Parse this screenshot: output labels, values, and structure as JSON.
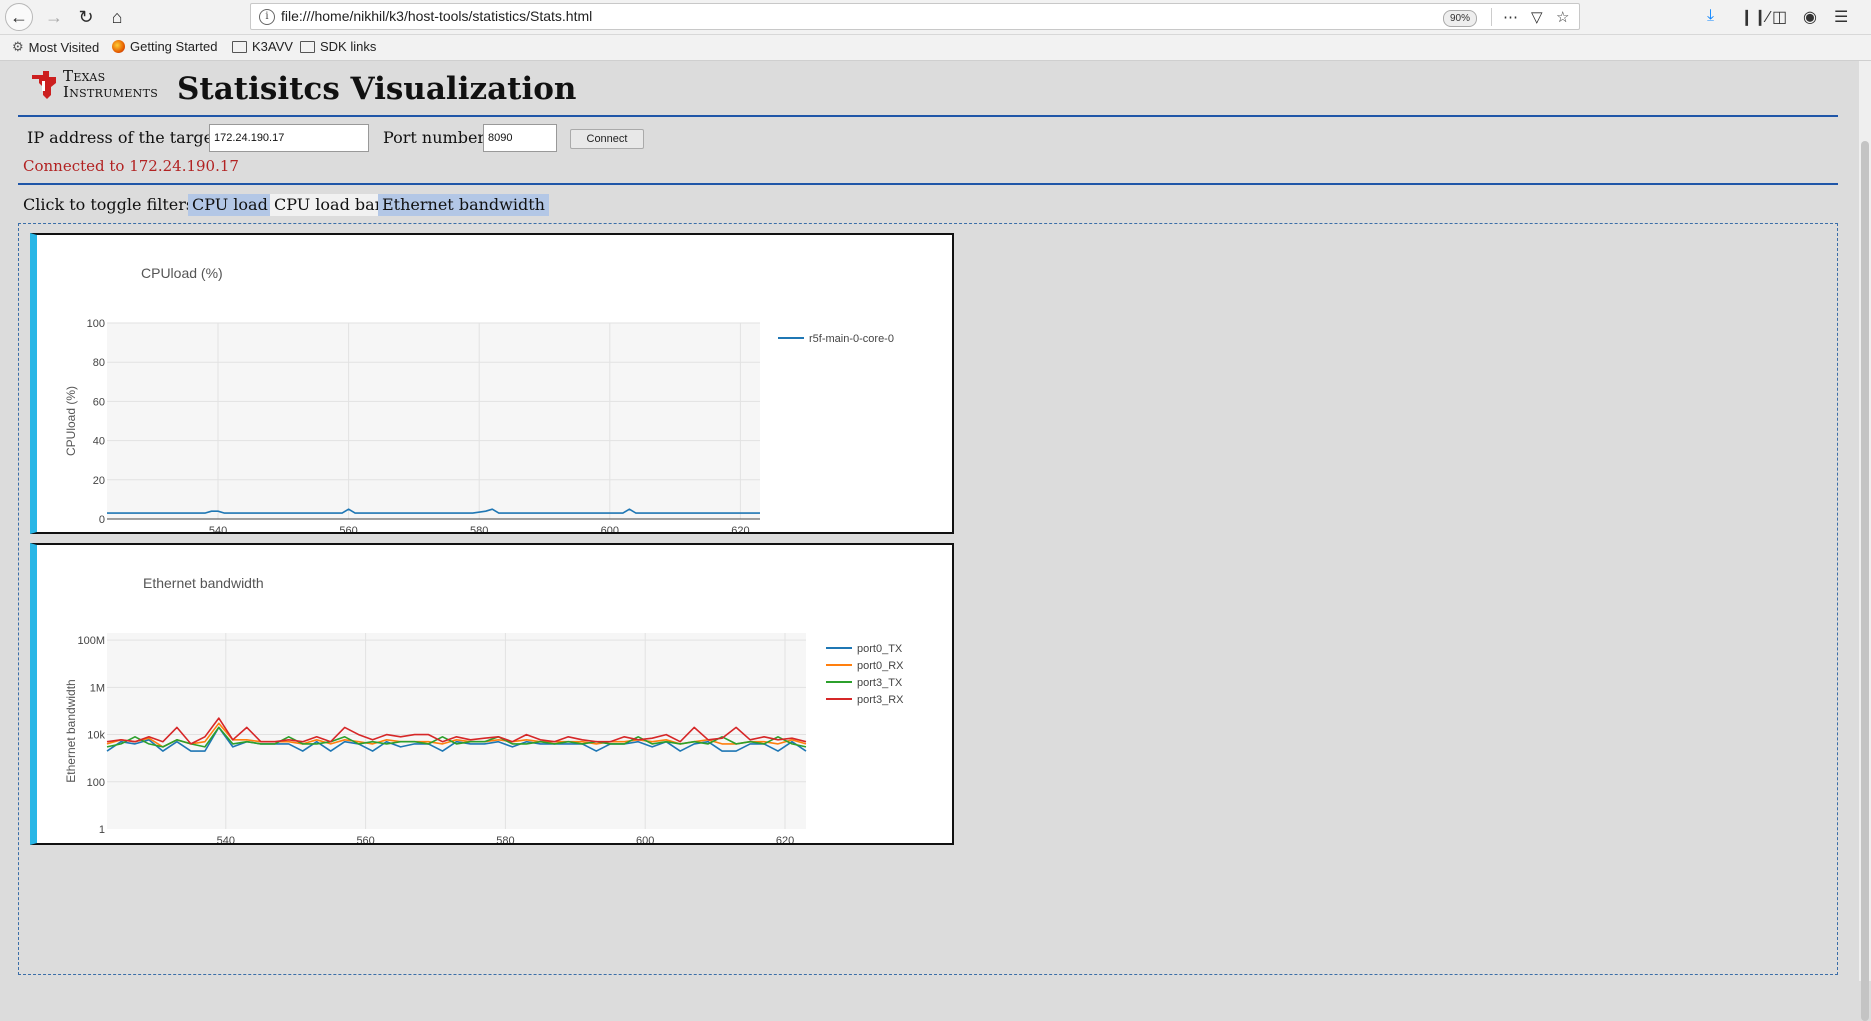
{
  "browser": {
    "url": "file:///home/nikhil/k3/host-tools/statistics/Stats.html",
    "zoom": "90%",
    "bookmarks": [
      "Most Visited",
      "Getting Started",
      "K3AVV",
      "SDK links"
    ]
  },
  "page": {
    "logo": {
      "line1_cap": "T",
      "line1_rest": "EXAS",
      "line2_cap": "I",
      "line2_rest": "NSTRUMENTS"
    },
    "title": "Statisitcs Visualization",
    "ip_label": "IP address of the target:",
    "ip_value": "172.24.190.17",
    "port_label": "Port number:",
    "port_value": "8090",
    "connect_label": "Connect",
    "status": "Connected to 172.24.190.17",
    "filters_label": "Click to toggle filters:",
    "filters": [
      {
        "label": "CPU load",
        "active": true
      },
      {
        "label": "CPU load bar",
        "active": false
      },
      {
        "label": "Ethernet bandwidth",
        "active": true
      }
    ]
  },
  "chart_data": [
    {
      "type": "line",
      "title": "CPUload (%)",
      "ylabel": "CPUload (%)",
      "xlabel": "",
      "xlim": [
        523,
        623
      ],
      "ylim": [
        0,
        100
      ],
      "xticks": [
        540,
        560,
        580,
        600,
        620
      ],
      "yticks": [
        0,
        20,
        40,
        60,
        80,
        100
      ],
      "legend": "top-right",
      "series": [
        {
          "name": "r5f-main-0-core-0",
          "color": "#1f77b4",
          "x": [
            523,
            525,
            530,
            535,
            538,
            539,
            540,
            541,
            545,
            550,
            555,
            559,
            560,
            561,
            565,
            570,
            575,
            579,
            581,
            582,
            583,
            585,
            590,
            595,
            600,
            602,
            603,
            604,
            605,
            610,
            615,
            620,
            623
          ],
          "y": [
            3,
            3,
            3,
            3,
            3,
            4,
            4,
            3,
            3,
            3,
            3,
            3,
            5,
            3,
            3,
            3,
            3,
            3,
            4,
            5,
            3,
            3,
            3,
            3,
            3,
            3,
            5,
            3,
            3,
            3,
            3,
            3,
            3
          ]
        }
      ]
    },
    {
      "type": "line",
      "title": "Ethernet bandwidth",
      "ylabel": "Ethernet bandwidth",
      "xlabel": "",
      "xlim": [
        523,
        623
      ],
      "ylim": [
        1,
        200000000
      ],
      "yscale": "log",
      "xticks": [
        540,
        560,
        580,
        600,
        620
      ],
      "yticks": [
        1,
        100,
        10000,
        1000000,
        100000000
      ],
      "ytick_labels": [
        "1",
        "100",
        "10k",
        "1M",
        "100M"
      ],
      "legend": "top-right",
      "series": [
        {
          "name": "port0_TX",
          "color": "#1f77b4",
          "x": [
            523,
            525,
            527,
            529,
            531,
            533,
            535,
            537,
            539,
            541,
            543,
            545,
            547,
            549,
            551,
            553,
            555,
            557,
            559,
            561,
            563,
            565,
            567,
            569,
            571,
            573,
            575,
            577,
            579,
            581,
            583,
            585,
            587,
            589,
            591,
            593,
            595,
            597,
            599,
            601,
            603,
            605,
            607,
            609,
            611,
            613,
            615,
            617,
            619,
            621,
            623
          ],
          "y": [
            2000,
            5000,
            4000,
            6000,
            2000,
            5000,
            2000,
            2000,
            20000,
            3000,
            5000,
            4000,
            4000,
            4000,
            2000,
            5000,
            2000,
            5000,
            4000,
            2000,
            5000,
            3000,
            4000,
            4000,
            2000,
            5000,
            4000,
            4000,
            5000,
            3000,
            5000,
            4000,
            4000,
            4000,
            4000,
            2000,
            4000,
            4000,
            5000,
            3000,
            5000,
            2000,
            4000,
            5000,
            2000,
            2000,
            4000,
            4000,
            2000,
            5000,
            2000
          ]
        },
        {
          "name": "port0_RX",
          "color": "#ff7f0e",
          "x": [
            523,
            525,
            527,
            529,
            531,
            533,
            535,
            537,
            539,
            541,
            543,
            545,
            547,
            549,
            551,
            553,
            555,
            557,
            559,
            561,
            563,
            565,
            567,
            569,
            571,
            573,
            575,
            577,
            579,
            581,
            583,
            585,
            587,
            589,
            591,
            593,
            595,
            597,
            599,
            601,
            603,
            605,
            607,
            609,
            611,
            613,
            615,
            617,
            619,
            621,
            623
          ],
          "y": [
            4000,
            6000,
            5000,
            7000,
            3000,
            6000,
            4000,
            5000,
            30000,
            6000,
            6000,
            5000,
            5000,
            5000,
            4000,
            6000,
            4000,
            6000,
            5000,
            4000,
            6000,
            5000,
            5000,
            5000,
            4000,
            6000,
            5000,
            5000,
            6000,
            5000,
            6000,
            5000,
            5000,
            5000,
            5000,
            4000,
            5000,
            5000,
            6000,
            5000,
            6000,
            4000,
            5000,
            6000,
            4000,
            4000,
            5000,
            5000,
            4000,
            6000,
            4000
          ]
        },
        {
          "name": "port3_TX",
          "color": "#2ca02c",
          "x": [
            523,
            525,
            527,
            529,
            531,
            533,
            535,
            537,
            539,
            541,
            543,
            545,
            547,
            549,
            551,
            553,
            555,
            557,
            559,
            561,
            563,
            565,
            567,
            569,
            571,
            573,
            575,
            577,
            579,
            581,
            583,
            585,
            587,
            589,
            591,
            593,
            595,
            597,
            599,
            601,
            603,
            605,
            607,
            609,
            611,
            613,
            615,
            617,
            619,
            621,
            623
          ],
          "y": [
            3000,
            4000,
            8000,
            4000,
            3000,
            6000,
            4000,
            3000,
            20000,
            4000,
            5000,
            4000,
            4000,
            8000,
            4000,
            4000,
            5000,
            8000,
            4000,
            5000,
            4000,
            5000,
            5000,
            4000,
            8000,
            4000,
            5000,
            5000,
            8000,
            4000,
            4000,
            5000,
            4000,
            5000,
            4000,
            5000,
            4000,
            4000,
            8000,
            4000,
            5000,
            4000,
            5000,
            4000,
            8000,
            4000,
            5000,
            4000,
            8000,
            4000,
            3000
          ]
        },
        {
          "name": "port3_RX",
          "color": "#d62728",
          "x": [
            523,
            525,
            527,
            529,
            531,
            533,
            535,
            537,
            539,
            541,
            543,
            545,
            547,
            549,
            551,
            553,
            555,
            557,
            559,
            561,
            563,
            565,
            567,
            569,
            571,
            573,
            575,
            577,
            579,
            581,
            583,
            585,
            587,
            589,
            591,
            593,
            595,
            597,
            599,
            601,
            603,
            605,
            607,
            609,
            611,
            613,
            615,
            617,
            619,
            621,
            623
          ],
          "y": [
            5000,
            6000,
            5000,
            8000,
            5000,
            20000,
            4000,
            8000,
            50000,
            6000,
            20000,
            5000,
            5000,
            6000,
            5000,
            8000,
            5000,
            20000,
            10000,
            6000,
            10000,
            8000,
            10000,
            10000,
            5000,
            8000,
            6000,
            7000,
            8000,
            5000,
            10000,
            6000,
            5000,
            8000,
            6000,
            5000,
            5000,
            8000,
            6000,
            7000,
            10000,
            5000,
            20000,
            6000,
            7000,
            20000,
            6000,
            8000,
            6000,
            7000,
            5000
          ]
        }
      ]
    }
  ]
}
